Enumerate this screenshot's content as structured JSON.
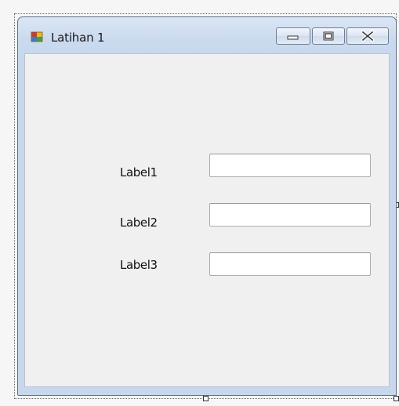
{
  "window": {
    "title": "Latihan 1",
    "icon": "form-app-icon"
  },
  "caption_buttons": {
    "minimize": "minimize-icon",
    "maximize": "maximize-icon",
    "close": "close-icon"
  },
  "form": {
    "labels": [
      "Label1",
      "Label2",
      "Label3"
    ],
    "textboxes": [
      {
        "value": ""
      },
      {
        "value": ""
      },
      {
        "value": ""
      }
    ]
  },
  "colors": {
    "titlebar": "#c8d8ec",
    "client": "#f0f0f0",
    "textbox_border": "#abadb3"
  }
}
